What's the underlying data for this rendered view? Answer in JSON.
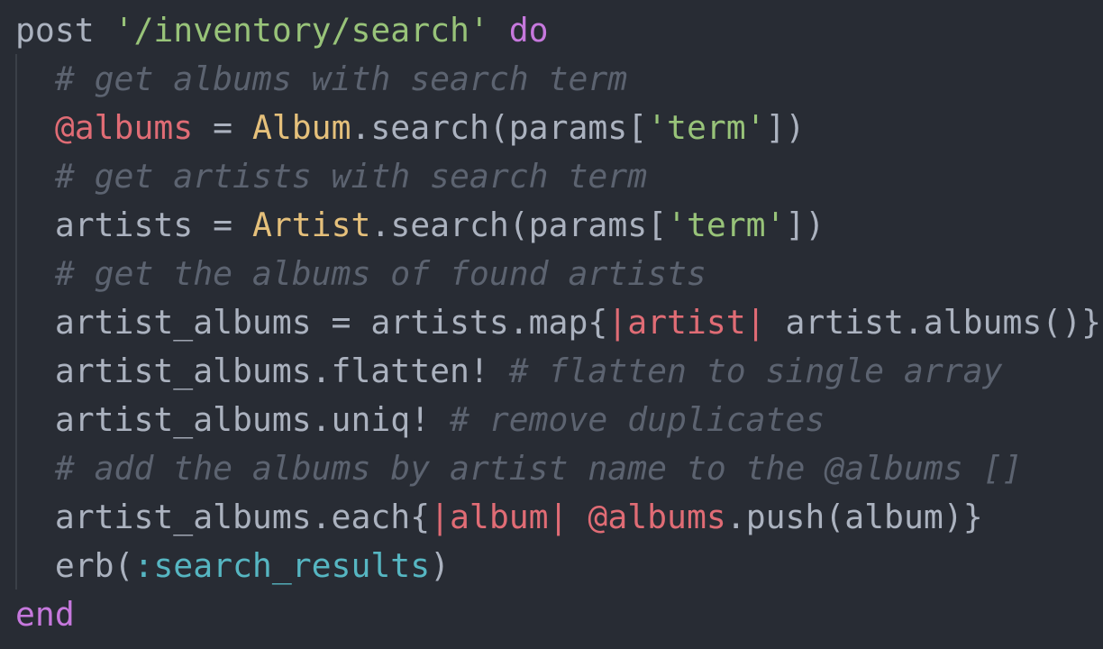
{
  "code": {
    "language": "ruby",
    "line1": {
      "method": "post",
      "space": " ",
      "route": "'/inventory/search'",
      "keyword_do": "do"
    },
    "line2": {
      "indent": "  ",
      "comment": "# get albums with search term"
    },
    "line3": {
      "indent": "  ",
      "ivar": "@albums",
      "op": " = ",
      "class": "Album",
      "call_open": ".search(params[",
      "arg": "'term'",
      "call_close": "])"
    },
    "line4": {
      "indent": "  ",
      "comment": "# get artists with search term"
    },
    "line5": {
      "indent": "  ",
      "var": "artists",
      "op": " = ",
      "class": "Artist",
      "call_open": ".search(params[",
      "arg": "'term'",
      "call_close": "])"
    },
    "line6": {
      "indent": "  ",
      "comment": "# get the albums of found artists"
    },
    "line7": {
      "indent": "  ",
      "lhs": "artist_albums = artists.map{",
      "block_param": "|artist|",
      "body": " artist.albums()}"
    },
    "line8": {
      "indent": "  ",
      "code": "artist_albums.flatten! ",
      "comment": "# flatten to single array"
    },
    "line9": {
      "indent": "  ",
      "code": "artist_albums.uniq! ",
      "comment": "# remove duplicates"
    },
    "line10": {
      "indent": "  ",
      "comment": "# add the albums by artist name to the @albums []"
    },
    "line11": {
      "indent": "  ",
      "lhs": "artist_albums.each{",
      "block_param": "|album|",
      "space": " ",
      "ivar": "@albums",
      "body": ".push(album)}"
    },
    "line12": {
      "indent": "  ",
      "call_open": "erb(",
      "symbol": ":search_results",
      "call_close": ")"
    },
    "line13": {
      "keyword_end": "end"
    }
  },
  "theme": {
    "background": "#282c34",
    "foreground": "#abb2bf",
    "keyword": "#c678dd",
    "string": "#98c379",
    "comment": "#5c6370",
    "instance_variable": "#e06c75",
    "constant": "#e5c07b",
    "symbol": "#56b6c2"
  }
}
